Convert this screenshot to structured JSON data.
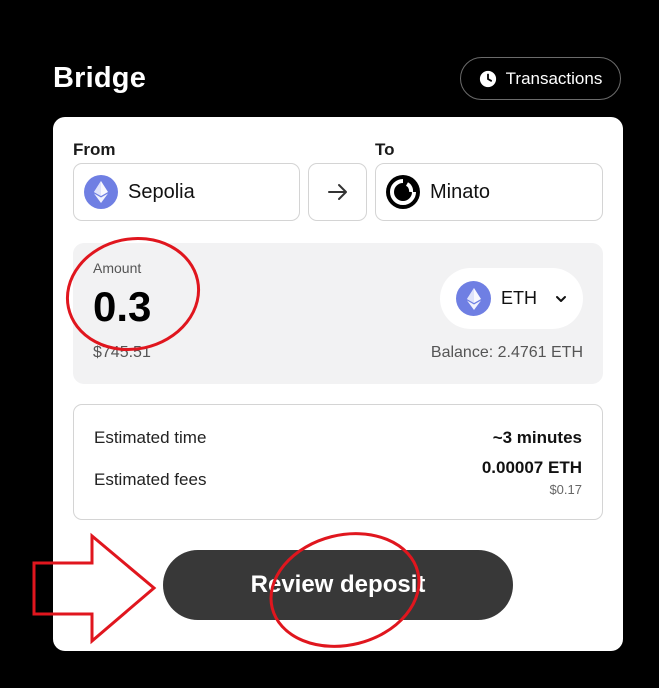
{
  "header": {
    "title": "Bridge",
    "transactions_label": "Transactions",
    "transactions_icon": "clock-icon"
  },
  "from": {
    "label": "From",
    "network": "Sepolia",
    "icon": "ethereum-icon"
  },
  "to": {
    "label": "To",
    "network": "Minato",
    "icon": "minato-logo-icon"
  },
  "swap_icon": "arrow-right-icon",
  "amount": {
    "label": "Amount",
    "value": "0.3",
    "usd_value": "$745.51",
    "token": "ETH",
    "token_icon": "ethereum-icon",
    "balance": "Balance: 2.4761 ETH"
  },
  "estimates": {
    "time_label": "Estimated time",
    "time_value": "~3 minutes",
    "fees_label": "Estimated fees",
    "fees_value": "0.00007 ETH",
    "fees_usd": "$0.17"
  },
  "review_button_label": "Review deposit",
  "colors": {
    "background": "#000000",
    "card": "#ffffff",
    "button": "#383838",
    "eth": "#6f7fe3",
    "annotation": "#e0161e"
  }
}
